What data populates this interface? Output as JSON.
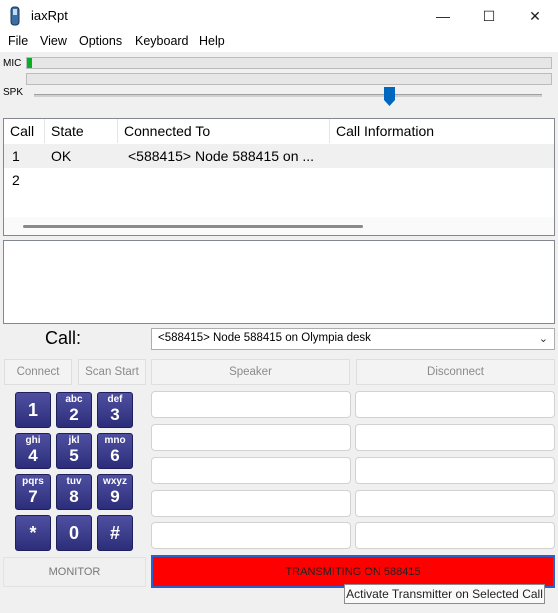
{
  "window": {
    "title": "iaxRpt",
    "minimize": "—",
    "maximize": "☐",
    "close": "✕"
  },
  "menu": [
    "File",
    "View",
    "Options",
    "Keyboard",
    "Help"
  ],
  "meters": {
    "mic_label": "MIC",
    "spk_label": "SPK",
    "mic_level": 0.01,
    "speaker_volume": 0.7
  },
  "table": {
    "headers": [
      "Call",
      "State",
      "Connected To",
      "Call Information"
    ],
    "rows": [
      {
        "call": "1",
        "state": "OK",
        "connected_to": "<588415> Node 588415 on ...",
        "info": ""
      },
      {
        "call": "2",
        "state": "",
        "connected_to": "",
        "info": ""
      }
    ]
  },
  "call": {
    "label": "Call:",
    "selected": "<588415> Node 588415 on Olympia desk"
  },
  "buttons": {
    "connect": "Connect",
    "scan_start": "Scan Start",
    "speaker": "Speaker",
    "disconnect": "Disconnect",
    "monitor": "MONITOR",
    "transmit": "TRANSMITING ON 588415"
  },
  "keypad": [
    {
      "main": "1",
      "sub": ""
    },
    {
      "main": "2",
      "sub": "abc"
    },
    {
      "main": "3",
      "sub": "def"
    },
    {
      "main": "4",
      "sub": "ghi"
    },
    {
      "main": "5",
      "sub": "jkl"
    },
    {
      "main": "6",
      "sub": "mno"
    },
    {
      "main": "7",
      "sub": "pqrs"
    },
    {
      "main": "8",
      "sub": "tuv"
    },
    {
      "main": "9",
      "sub": "wxyz"
    },
    {
      "main": "*",
      "sub": ""
    },
    {
      "main": "0",
      "sub": ""
    },
    {
      "main": "#",
      "sub": ""
    }
  ],
  "tooltip": "Activate Transmitter on Selected Call",
  "colors": {
    "transmit_bg": "#ff0000",
    "key_bg": "#3a3b8c",
    "mic_level": "#06b025",
    "slider_thumb": "#0067c0"
  }
}
